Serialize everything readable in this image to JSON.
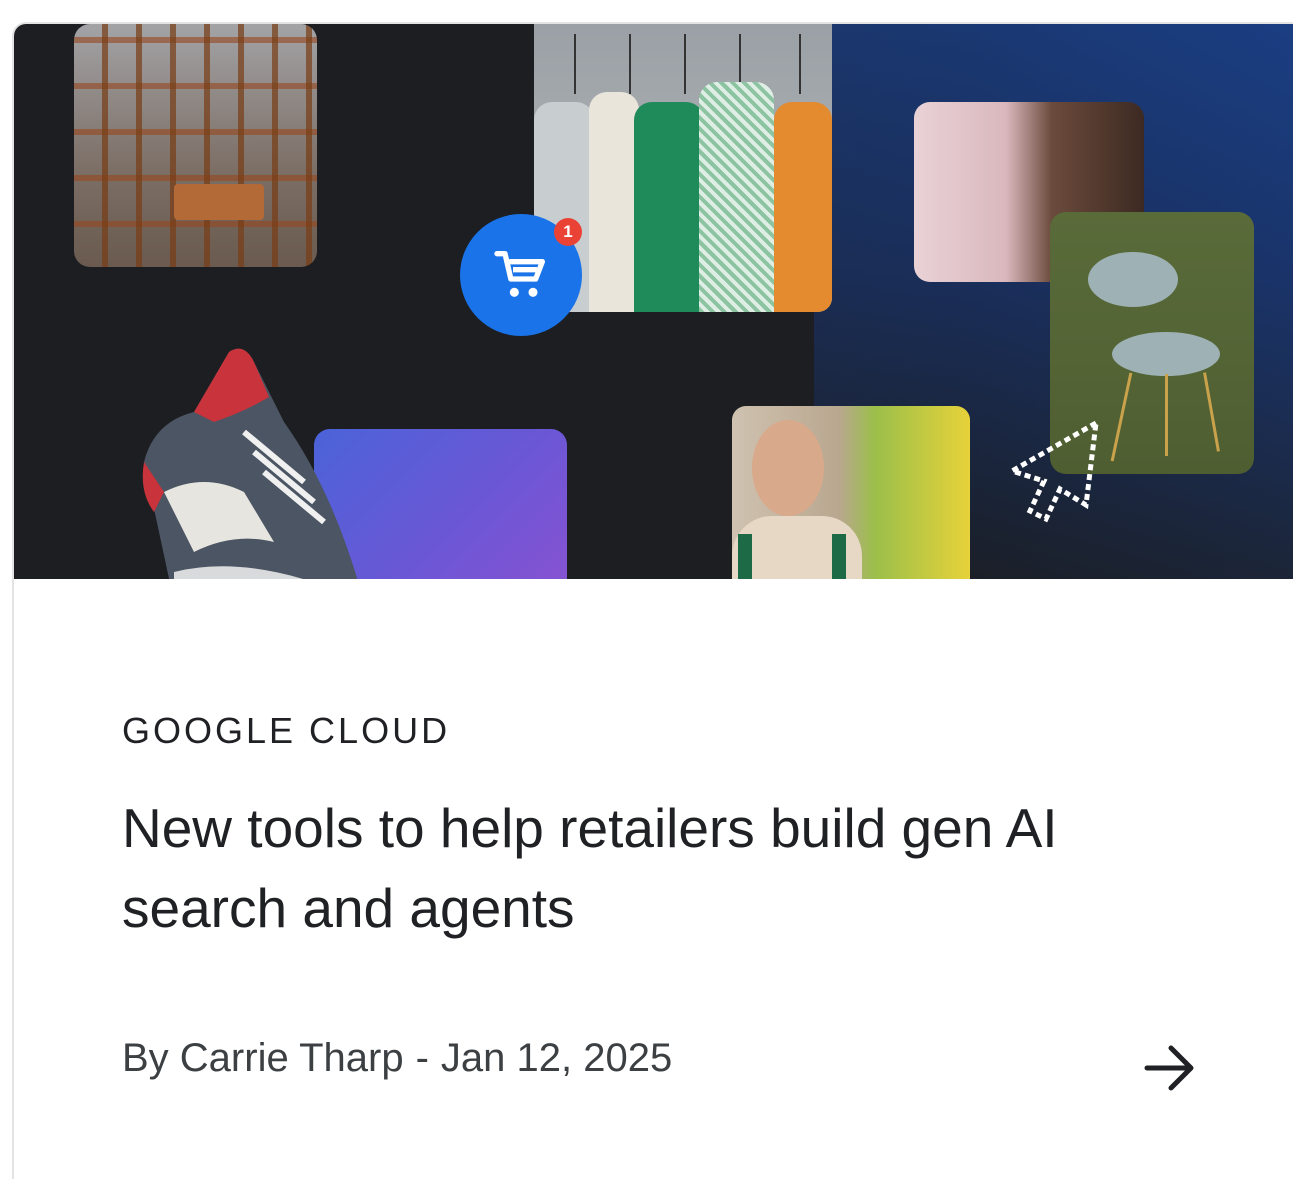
{
  "card": {
    "category": "GOOGLE CLOUD",
    "title": "New tools to help retailers build gen AI search and agents",
    "author": "By Carrie Tharp",
    "separator": "-",
    "date": "Jan 12, 2025",
    "notification_count": "1"
  },
  "icons": {
    "cart": "shopping-cart-icon",
    "pointer": "cursor-pointer-icon",
    "arrow": "arrow-right-icon"
  },
  "colors": {
    "text": "#202124",
    "meta": "#3c4043",
    "cart_blue": "#1a73e8",
    "badge_red": "#ea4335"
  }
}
